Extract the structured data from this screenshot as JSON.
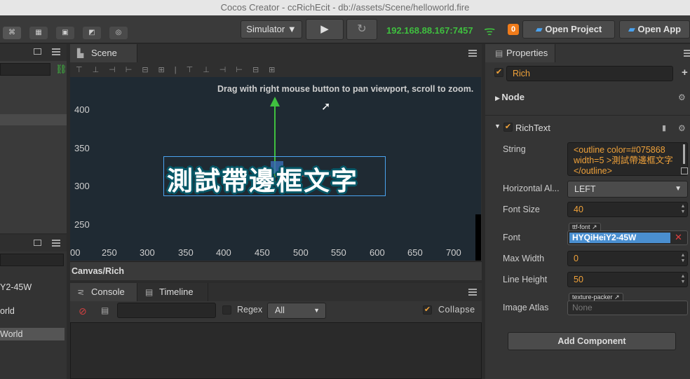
{
  "window": {
    "title": "Cocos Creator - ccRichEcit - db://assets/Scene/helloworld.fire"
  },
  "toolbar": {
    "simulator_label": "Simulator",
    "play_icon": "play-icon",
    "refresh_icon": "refresh-icon",
    "ip_address": "192.168.88.167:7457",
    "badge_count": "0",
    "open_project_label": "Open Project",
    "open_app_label": "Open App",
    "colors": {
      "ip": "#3fbf3f",
      "badge": "#f07b1a",
      "accent": "#f0a23a"
    }
  },
  "left_panel": {
    "items": [
      "Y2-45W",
      "orld",
      "World"
    ]
  },
  "scene": {
    "tab_label": "Scene",
    "hint": "Drag with right mouse button to pan viewport, scroll to zoom.",
    "rich_text": "測試帶邊框文字",
    "y_ticks": [
      "400",
      "350",
      "300",
      "250"
    ],
    "x_ticks": [
      "00",
      "250",
      "300",
      "350",
      "400",
      "450",
      "500",
      "550",
      "600",
      "650",
      "700"
    ],
    "breadcrumb": "Canvas/Rich"
  },
  "console": {
    "tab_label": "Console",
    "timeline_label": "Timeline",
    "regex_label": "Regex",
    "filter_value": "All",
    "collapse_label": "Collapse"
  },
  "properties": {
    "tab_label": "Properties",
    "node_name": "Rich",
    "node_section": "Node",
    "component_name": "RichText",
    "string_label": "String",
    "string_value": "<outline color=#075868 width=5 >測試帶邊框文字</outline>",
    "horizontal_align_label": "Horizontal Al...",
    "horizontal_align_value": "LEFT",
    "font_size_label": "Font Size",
    "font_size_value": "40",
    "font_label": "Font",
    "font_tag": "ttf-font",
    "font_value": "HYQiHeiY2-45W",
    "max_width_label": "Max Width",
    "max_width_value": "0",
    "line_height_label": "Line Height",
    "line_height_value": "50",
    "image_atlas_label": "Image Atlas",
    "image_atlas_tag": "texture-packer",
    "image_atlas_value": "None",
    "add_component_label": "Add Component"
  }
}
